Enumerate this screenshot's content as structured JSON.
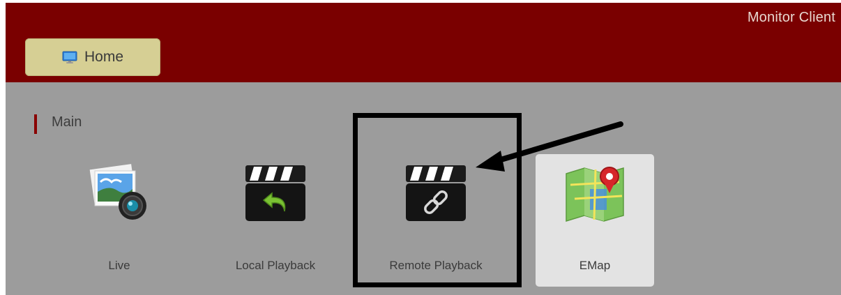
{
  "window": {
    "title": "Monitor Client"
  },
  "tabs": [
    {
      "label": "Home",
      "icon": "monitor-icon",
      "active": true
    }
  ],
  "section": {
    "title": "Main"
  },
  "tiles": [
    {
      "label": "Live",
      "icon": "photo-camera-icon"
    },
    {
      "label": "Local Playback",
      "icon": "clapperboard-back-icon"
    },
    {
      "label": "Remote Playback",
      "icon": "clapperboard-link-icon",
      "highlighted": true
    },
    {
      "label": "EMap",
      "icon": "map-pin-icon",
      "selected": true
    }
  ],
  "colors": {
    "header_bg": "#7a0000",
    "content_bg": "#9c9c9c",
    "tab_bg": "#d6cf94",
    "section_accent": "#8a0000",
    "selected_tile_bg": "#e3e3e3",
    "annotation": "#000000"
  }
}
